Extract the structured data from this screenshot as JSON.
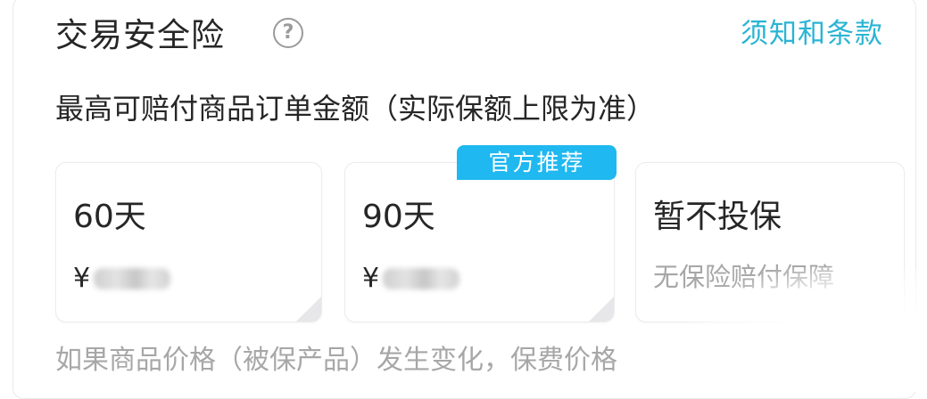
{
  "header": {
    "title": "交易安全险",
    "help_icon_glyph": "?",
    "terms_link": "须知和条款"
  },
  "subtitle": "最高可赔付商品订单金额（实际保额上限为准）",
  "options": [
    {
      "label": "60天",
      "currency": "¥"
    },
    {
      "label": "90天",
      "currency": "¥",
      "badge": "官方推荐"
    },
    {
      "label": "暂不投保",
      "note": "无保险赔付保障"
    }
  ],
  "footnote": "如果商品价格（被保产品）发生变化，保费价格",
  "colors": {
    "link": "#2ab4d4",
    "badge": "#1fb8f0",
    "text": "#262626",
    "muted": "#a7a7a7"
  }
}
